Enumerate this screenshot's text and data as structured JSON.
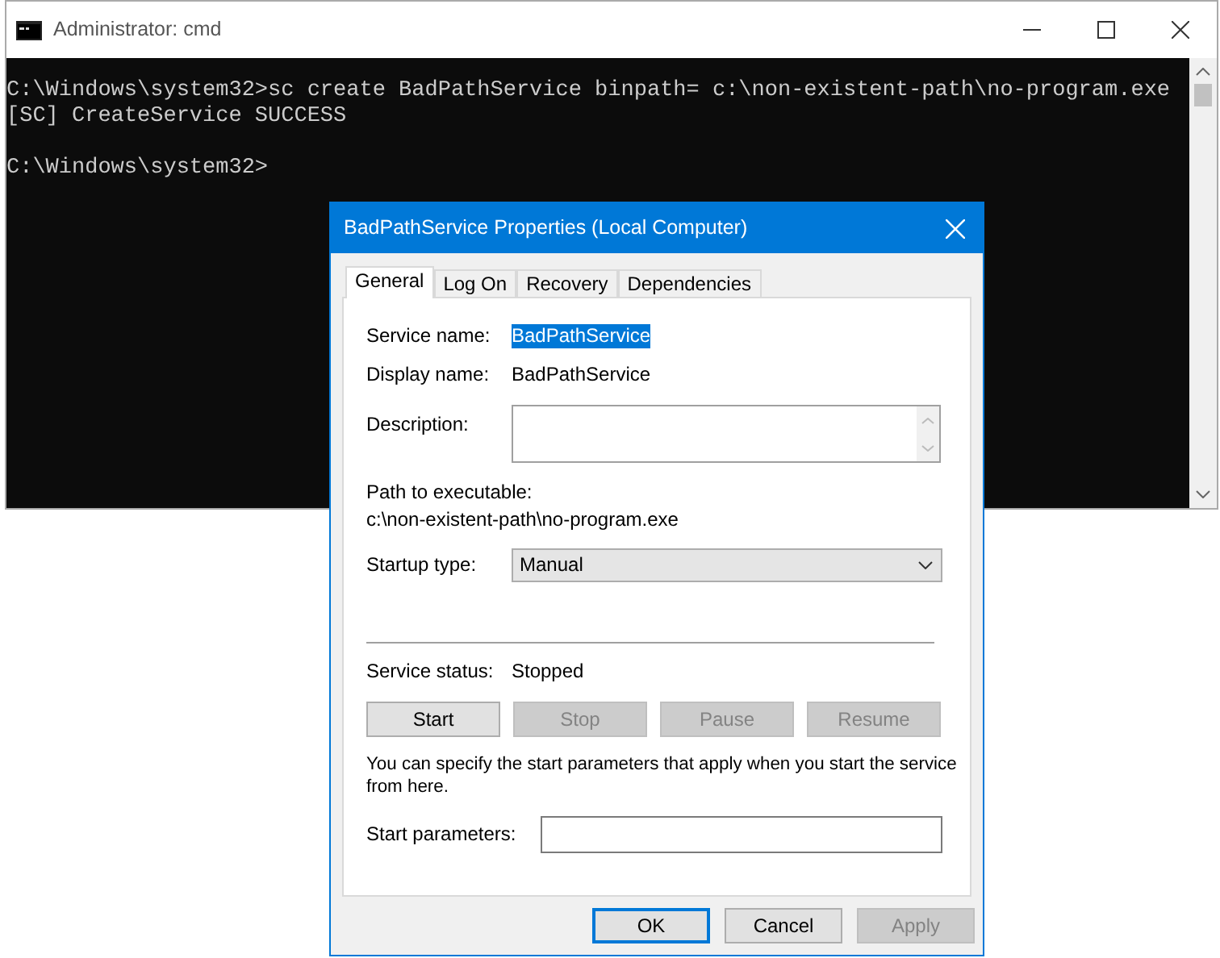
{
  "console_window": {
    "title": "Administrator: cmd",
    "output_blocks": [
      [
        "C:\\Windows\\system32>sc create BadPathService binpath= c:\\non-existent-path\\no-program.exe",
        "[SC] CreateService SUCCESS"
      ],
      [
        "C:\\Windows\\system32>"
      ]
    ]
  },
  "dialog": {
    "title": "BadPathService Properties (Local Computer)",
    "tabs": [
      {
        "label": "General",
        "selected": true
      },
      {
        "label": "Log On",
        "selected": false
      },
      {
        "label": "Recovery",
        "selected": false
      },
      {
        "label": "Dependencies",
        "selected": false
      }
    ],
    "service_name": {
      "label": "Service name:",
      "value": "BadPathService",
      "selected": true
    },
    "display_name": {
      "label": "Display name:",
      "value": "BadPathService"
    },
    "description": {
      "label": "Description:"
    },
    "path": {
      "label": "Path to executable:",
      "value": "c:\\non-existent-path\\no-program.exe"
    },
    "startup_type": {
      "label": "Startup type:",
      "value": "Manual"
    },
    "service_status": {
      "label": "Service status:",
      "value": "Stopped"
    },
    "service_buttons": [
      {
        "label": "Start",
        "disabled": false
      },
      {
        "label": "Stop",
        "disabled": true
      },
      {
        "label": "Pause",
        "disabled": true
      },
      {
        "label": "Resume",
        "disabled": true
      }
    ],
    "hint": "You can specify the start parameters that apply when you start the service from here.",
    "start_parameters": {
      "label": "Start parameters:"
    },
    "footer_buttons": [
      {
        "label": "OK",
        "disabled": false,
        "default": true
      },
      {
        "label": "Cancel",
        "disabled": false,
        "default": false
      },
      {
        "label": "Apply",
        "disabled": true,
        "default": false
      }
    ]
  }
}
